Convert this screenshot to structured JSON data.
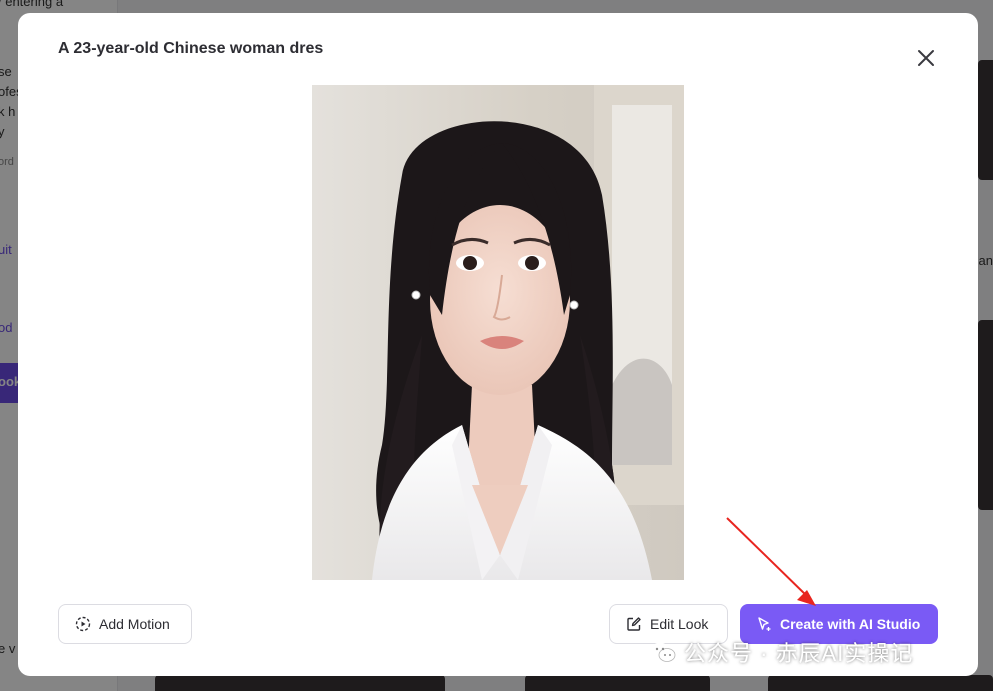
{
  "background": {
    "left_fragments": [
      "/ entering a",
      "se",
      "ofes",
      "k h",
      "y",
      "ord",
      "uit",
      "od",
      "ook",
      "e v"
    ],
    "right_fragment": "an"
  },
  "modal": {
    "title": "A 23-year-old Chinese woman dres",
    "close_icon": "close-icon",
    "image_alt": "AI generated portrait of a young woman in a white blazer",
    "buttons": {
      "add_motion": "Add Motion",
      "edit_look": "Edit Look",
      "create_with_ai_studio": "Create with AI Studio"
    },
    "colors": {
      "primary": "#7a5af5",
      "annotation_arrow": "#e8251f"
    }
  },
  "watermark": {
    "text": "公众号 · 赤辰AI实操记",
    "icon": "wechat-icon"
  }
}
